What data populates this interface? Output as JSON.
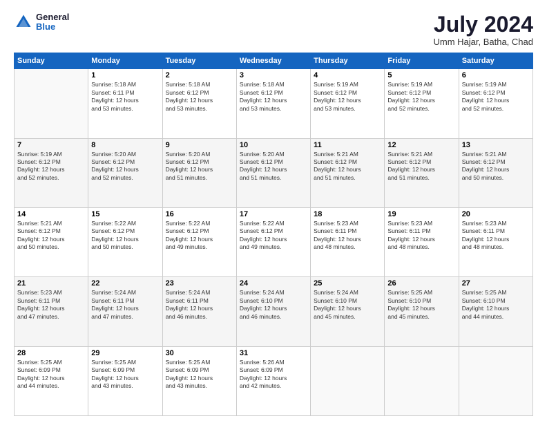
{
  "header": {
    "logo_general": "General",
    "logo_blue": "Blue",
    "month_title": "July 2024",
    "location": "Umm Hajar, Batha, Chad"
  },
  "weekdays": [
    "Sunday",
    "Monday",
    "Tuesday",
    "Wednesday",
    "Thursday",
    "Friday",
    "Saturday"
  ],
  "weeks": [
    [
      {
        "day": "",
        "info": ""
      },
      {
        "day": "1",
        "info": "Sunrise: 5:18 AM\nSunset: 6:11 PM\nDaylight: 12 hours\nand 53 minutes."
      },
      {
        "day": "2",
        "info": "Sunrise: 5:18 AM\nSunset: 6:12 PM\nDaylight: 12 hours\nand 53 minutes."
      },
      {
        "day": "3",
        "info": "Sunrise: 5:18 AM\nSunset: 6:12 PM\nDaylight: 12 hours\nand 53 minutes."
      },
      {
        "day": "4",
        "info": "Sunrise: 5:19 AM\nSunset: 6:12 PM\nDaylight: 12 hours\nand 53 minutes."
      },
      {
        "day": "5",
        "info": "Sunrise: 5:19 AM\nSunset: 6:12 PM\nDaylight: 12 hours\nand 52 minutes."
      },
      {
        "day": "6",
        "info": "Sunrise: 5:19 AM\nSunset: 6:12 PM\nDaylight: 12 hours\nand 52 minutes."
      }
    ],
    [
      {
        "day": "7",
        "info": "Sunrise: 5:19 AM\nSunset: 6:12 PM\nDaylight: 12 hours\nand 52 minutes."
      },
      {
        "day": "8",
        "info": "Sunrise: 5:20 AM\nSunset: 6:12 PM\nDaylight: 12 hours\nand 52 minutes."
      },
      {
        "day": "9",
        "info": "Sunrise: 5:20 AM\nSunset: 6:12 PM\nDaylight: 12 hours\nand 51 minutes."
      },
      {
        "day": "10",
        "info": "Sunrise: 5:20 AM\nSunset: 6:12 PM\nDaylight: 12 hours\nand 51 minutes."
      },
      {
        "day": "11",
        "info": "Sunrise: 5:21 AM\nSunset: 6:12 PM\nDaylight: 12 hours\nand 51 minutes."
      },
      {
        "day": "12",
        "info": "Sunrise: 5:21 AM\nSunset: 6:12 PM\nDaylight: 12 hours\nand 51 minutes."
      },
      {
        "day": "13",
        "info": "Sunrise: 5:21 AM\nSunset: 6:12 PM\nDaylight: 12 hours\nand 50 minutes."
      }
    ],
    [
      {
        "day": "14",
        "info": "Sunrise: 5:21 AM\nSunset: 6:12 PM\nDaylight: 12 hours\nand 50 minutes."
      },
      {
        "day": "15",
        "info": "Sunrise: 5:22 AM\nSunset: 6:12 PM\nDaylight: 12 hours\nand 50 minutes."
      },
      {
        "day": "16",
        "info": "Sunrise: 5:22 AM\nSunset: 6:12 PM\nDaylight: 12 hours\nand 49 minutes."
      },
      {
        "day": "17",
        "info": "Sunrise: 5:22 AM\nSunset: 6:12 PM\nDaylight: 12 hours\nand 49 minutes."
      },
      {
        "day": "18",
        "info": "Sunrise: 5:23 AM\nSunset: 6:11 PM\nDaylight: 12 hours\nand 48 minutes."
      },
      {
        "day": "19",
        "info": "Sunrise: 5:23 AM\nSunset: 6:11 PM\nDaylight: 12 hours\nand 48 minutes."
      },
      {
        "day": "20",
        "info": "Sunrise: 5:23 AM\nSunset: 6:11 PM\nDaylight: 12 hours\nand 48 minutes."
      }
    ],
    [
      {
        "day": "21",
        "info": "Sunrise: 5:23 AM\nSunset: 6:11 PM\nDaylight: 12 hours\nand 47 minutes."
      },
      {
        "day": "22",
        "info": "Sunrise: 5:24 AM\nSunset: 6:11 PM\nDaylight: 12 hours\nand 47 minutes."
      },
      {
        "day": "23",
        "info": "Sunrise: 5:24 AM\nSunset: 6:11 PM\nDaylight: 12 hours\nand 46 minutes."
      },
      {
        "day": "24",
        "info": "Sunrise: 5:24 AM\nSunset: 6:10 PM\nDaylight: 12 hours\nand 46 minutes."
      },
      {
        "day": "25",
        "info": "Sunrise: 5:24 AM\nSunset: 6:10 PM\nDaylight: 12 hours\nand 45 minutes."
      },
      {
        "day": "26",
        "info": "Sunrise: 5:25 AM\nSunset: 6:10 PM\nDaylight: 12 hours\nand 45 minutes."
      },
      {
        "day": "27",
        "info": "Sunrise: 5:25 AM\nSunset: 6:10 PM\nDaylight: 12 hours\nand 44 minutes."
      }
    ],
    [
      {
        "day": "28",
        "info": "Sunrise: 5:25 AM\nSunset: 6:09 PM\nDaylight: 12 hours\nand 44 minutes."
      },
      {
        "day": "29",
        "info": "Sunrise: 5:25 AM\nSunset: 6:09 PM\nDaylight: 12 hours\nand 43 minutes."
      },
      {
        "day": "30",
        "info": "Sunrise: 5:25 AM\nSunset: 6:09 PM\nDaylight: 12 hours\nand 43 minutes."
      },
      {
        "day": "31",
        "info": "Sunrise: 5:26 AM\nSunset: 6:09 PM\nDaylight: 12 hours\nand 42 minutes."
      },
      {
        "day": "",
        "info": ""
      },
      {
        "day": "",
        "info": ""
      },
      {
        "day": "",
        "info": ""
      }
    ]
  ]
}
